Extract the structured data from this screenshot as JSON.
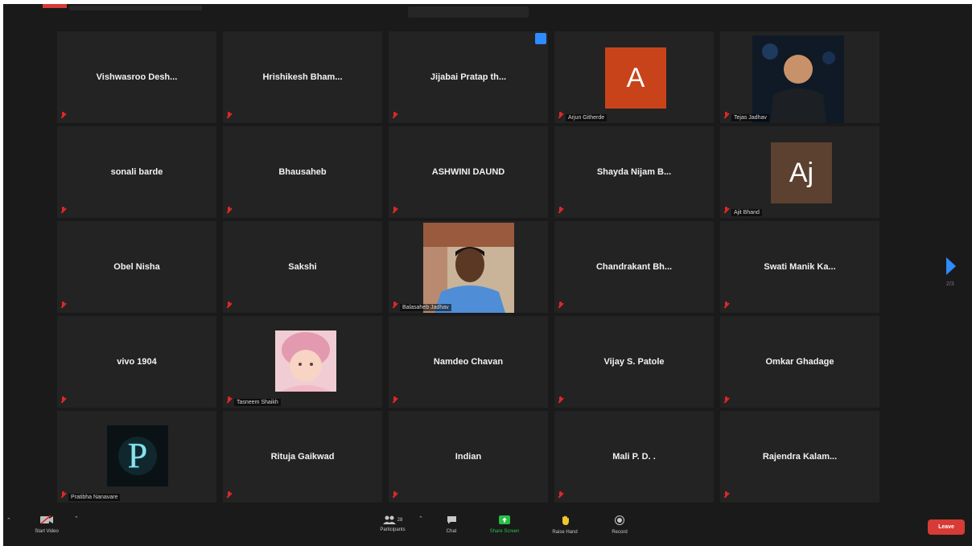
{
  "top_bar": {},
  "tiles": [
    {
      "name": "Vishwasroo  Desh..."
    },
    {
      "name": "Hrishikesh  Bham..."
    },
    {
      "name": "Jijabai Pratap th..."
    },
    {
      "label": "Arjun Githerde",
      "initial": "A"
    },
    {
      "label": "Tejas Jadhav"
    },
    {
      "name": "sonali barde"
    },
    {
      "name": "Bhausaheb"
    },
    {
      "name": "ASHWINI DAUND"
    },
    {
      "name": "Shayda Nijam B..."
    },
    {
      "label": "Ajit Bhand",
      "initial": "Aj"
    },
    {
      "name": "Obel Nisha"
    },
    {
      "name": "Sakshi"
    },
    {
      "label": "Balasaheb Jadhav"
    },
    {
      "name": "Chandrakant  Bh..."
    },
    {
      "name": "Swati Manik Ka..."
    },
    {
      "name": "vivo 1904"
    },
    {
      "label": "Tasneem Shaikh"
    },
    {
      "name": "Namdeo Chavan"
    },
    {
      "name": "Vijay S. Patole"
    },
    {
      "name": "Omkar Ghadage"
    },
    {
      "label": "Pratibha Nanavare"
    },
    {
      "name": "Rituja Gaikwad"
    },
    {
      "name": "Indian"
    },
    {
      "name": "Mali P. D. ."
    },
    {
      "name": "Rajendra  Kalam..."
    }
  ],
  "pagination": {
    "page_indicator": "2/3"
  },
  "toolbar": {
    "start_video": "Start Video",
    "participants": "Participants",
    "participant_count": "28",
    "chat": "Chat",
    "share_screen": "Share Screen",
    "raise_hand": "Raise Hand",
    "record": "Record",
    "leave": "Leave"
  },
  "colors": {
    "background": "#1a1a1a",
    "tile": "#232323",
    "muted_mic": "#e02828",
    "accent": "#2d8cff",
    "share_screen": "#27c043",
    "leave": "#d63b36",
    "avatar_a": "#c8431a",
    "avatar_aj": "#5c4030"
  }
}
